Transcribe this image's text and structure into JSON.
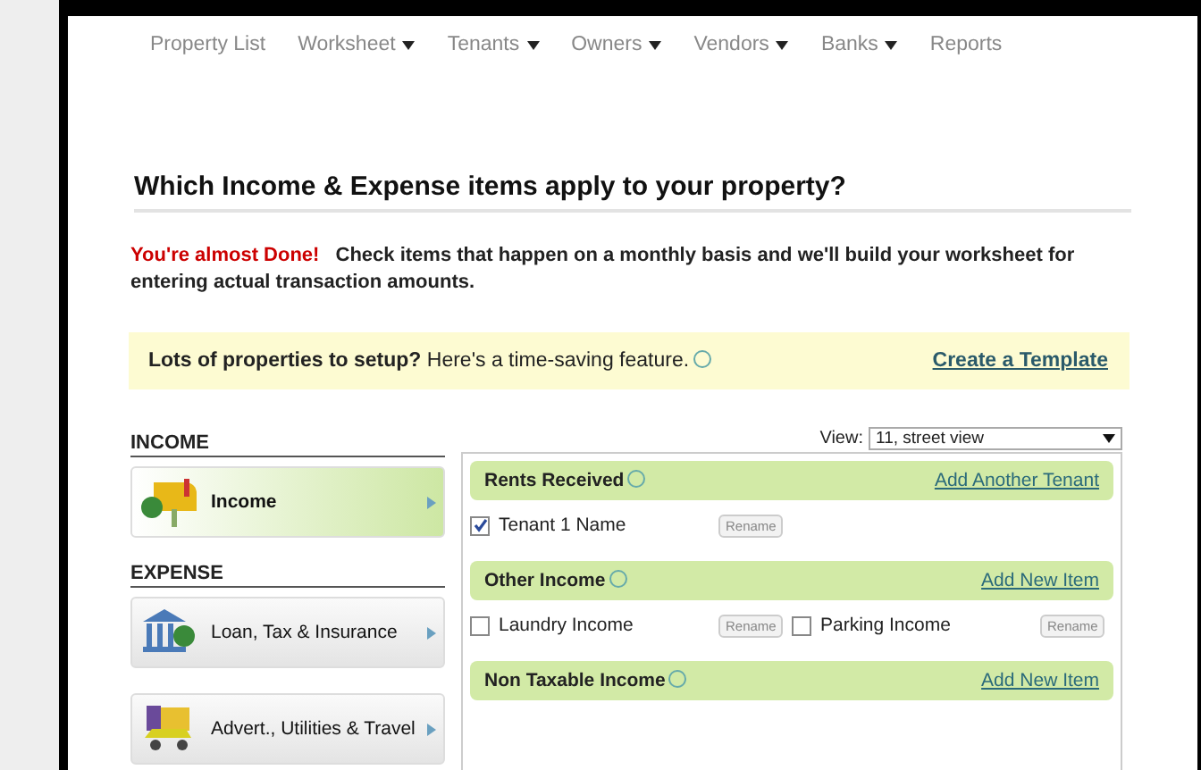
{
  "nav": [
    {
      "label": "Property List",
      "dropdown": false
    },
    {
      "label": "Worksheet",
      "dropdown": true
    },
    {
      "label": "Tenants",
      "dropdown": true
    },
    {
      "label": "Owners",
      "dropdown": true
    },
    {
      "label": "Vendors",
      "dropdown": true
    },
    {
      "label": "Banks",
      "dropdown": true
    },
    {
      "label": "Reports",
      "dropdown": false
    }
  ],
  "heading": "Which Income & Expense items apply to your property?",
  "intro": {
    "alert": "You're almost Done!",
    "text": "Check items that happen on a monthly basis and we'll build your worksheet for entering actual transaction amounts."
  },
  "banner": {
    "text": "**Lots of properties to setup?** Here's a time-saving feature.",
    "link": "Create a Template"
  },
  "sections": [
    {
      "title": "INCOME",
      "items": [
        {
          "label": "Income",
          "kind": "mailbox",
          "selected": true
        }
      ]
    },
    {
      "title": "EXPENSE",
      "items": [
        {
          "label": "Loan, Tax & Insurance",
          "kind": "bank",
          "selected": false
        },
        {
          "label": "Advert., Utilities & Travel",
          "kind": "car",
          "selected": false
        }
      ]
    }
  ],
  "view": {
    "label": "View:",
    "value": "11, street view"
  },
  "groups": [
    {
      "title": "Rents Received",
      "action": "Add Another Tenant",
      "items": [
        {
          "label": "Tenant 1 Name",
          "checked": true,
          "button": "Rename"
        }
      ]
    },
    {
      "title": "Other Income",
      "action": "Add New Item",
      "items": [
        {
          "label": "Laundry Income",
          "checked": false,
          "button": "Rename"
        },
        {
          "label": "Parking Income",
          "checked": false,
          "button": "Rename"
        }
      ]
    },
    {
      "title": "Non Taxable Income",
      "action": "Add New Item"
    }
  ]
}
